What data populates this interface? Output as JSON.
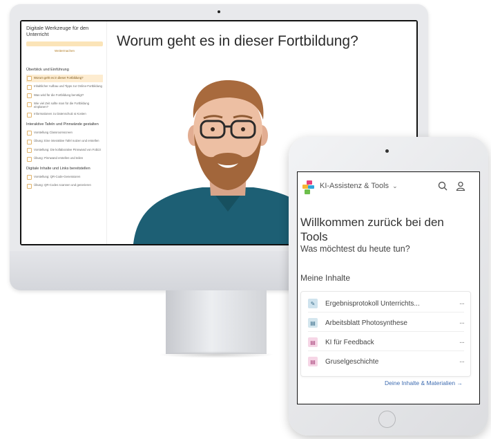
{
  "desktop": {
    "course": {
      "title": "Digitale Werkzeuge für den Unterricht",
      "progress_label": "",
      "resume_label": "Weitermachen",
      "sections": [
        {
          "title": "Überblick und Einführung",
          "lessons": [
            {
              "label": "Worum geht es in dieser Fortbildung?",
              "active": true
            },
            {
              "label": "Inhaltlicher Aufbau und Tipps zur Online-Fortbildung",
              "active": false
            },
            {
              "label": "Was wird für die Fortbildung benötigt?",
              "active": false
            },
            {
              "label": "Wie viel Zeit sollte man für die Fortbildung einplanen?",
              "active": false
            },
            {
              "label": "Informationen zu Datenschutz & Kosten",
              "active": false
            }
          ]
        },
        {
          "title": "Interaktive Tafeln und Pinnwände gestalten",
          "lessons": [
            {
              "label": "Vorstellung Classroomscreen",
              "active": false
            },
            {
              "label": "Übung: Eine interaktive Tafel nutzen und erstellen",
              "active": false
            },
            {
              "label": "Vorstellung: Die kollaborative Pinnwand von Fobizz",
              "active": false
            },
            {
              "label": "Übung: Pinnwand erstellen und teilen",
              "active": false
            }
          ]
        },
        {
          "title": "Digitale Inhalte und Links bereitstellen",
          "lessons": [
            {
              "label": "Vorstellung: QR-Code-Generatoren",
              "active": false
            },
            {
              "label": "Übung: QR-Codes scannen und generieren",
              "active": false
            }
          ]
        }
      ]
    },
    "video": {
      "heading": "Worum geht es in dieser Fortbildung?"
    }
  },
  "tablet": {
    "nav": {
      "app_name": "KI-Assistenz & Tools",
      "chevron_icon": "chevron-down-icon",
      "search_icon": "search-icon",
      "user_icon": "user-icon"
    },
    "welcome_title": "Willkommen zurück bei den Tools",
    "welcome_subtitle": "Was möchtest du heute tun?",
    "section_title": "Meine Inhalte",
    "items": [
      {
        "label": "Ergebnisprotokoll Unterrichts...",
        "icon": "edit-icon",
        "color": "#cfe3ee",
        "glyph": "✎",
        "glyph_color": "#3b6e8a"
      },
      {
        "label": "Arbeitsblatt Photosynthese",
        "icon": "document-icon",
        "color": "#d4e6ee",
        "glyph": "▤",
        "glyph_color": "#3b6e8a"
      },
      {
        "label": "KI für Feedback",
        "icon": "chat-icon",
        "color": "#f6d6e6",
        "glyph": "▤",
        "glyph_color": "#a6437a"
      },
      {
        "label": "Gruselgeschichte",
        "icon": "chat-icon",
        "color": "#f6d6e6",
        "glyph": "▤",
        "glyph_color": "#a6437a"
      }
    ],
    "more_label": "···",
    "footer_link": "Deine Inhalte & Materialien →"
  },
  "colors": {
    "accent_orange": "#fbe4b8",
    "link_blue": "#3d6bb0",
    "logo_colors": [
      "#e8407a",
      "#f7b733",
      "#2fa4dc",
      "#6dbf4b"
    ]
  }
}
